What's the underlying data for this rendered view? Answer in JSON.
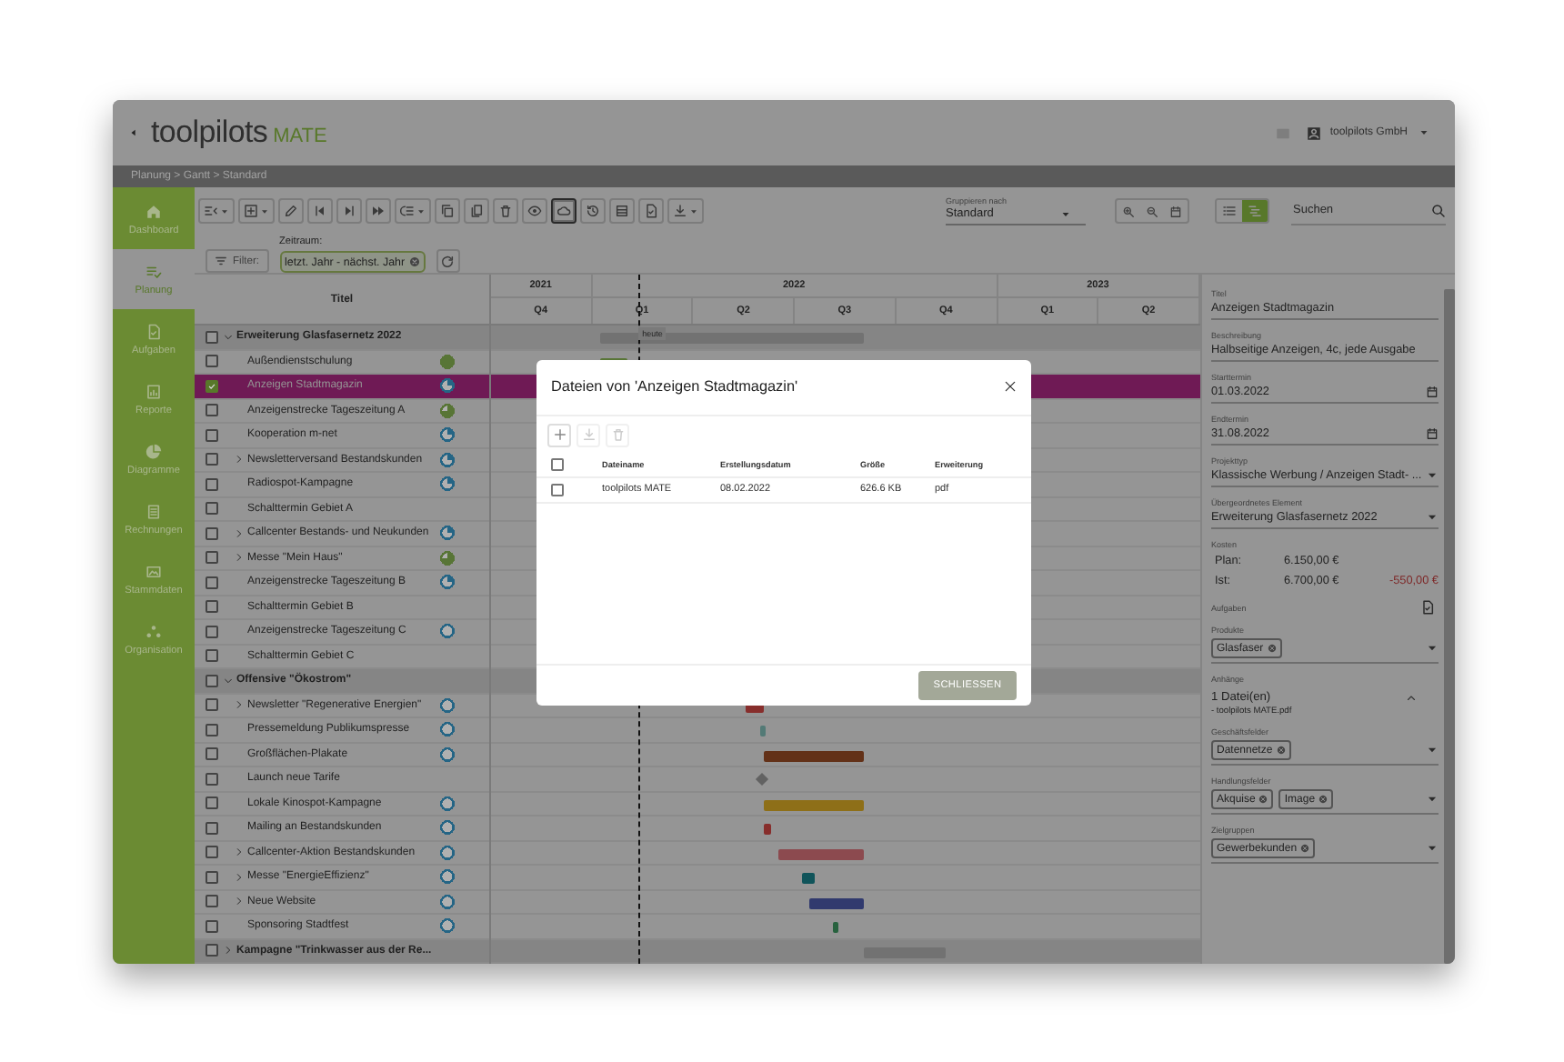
{
  "header": {
    "logo": {
      "name": "toolpilots",
      "accent": "MATE"
    },
    "company": "toolpilots GmbH"
  },
  "breadcrumb": "Planung > Gantt > Standard",
  "sidebar": {
    "items": [
      {
        "label": "Dashboard",
        "selected": false
      },
      {
        "label": "Planung",
        "selected": true
      },
      {
        "label": "Aufgaben",
        "selected": false
      },
      {
        "label": "Reporte",
        "selected": false
      },
      {
        "label": "Diagramme",
        "selected": false
      },
      {
        "label": "Rechnungen",
        "selected": false
      },
      {
        "label": "Stammdaten",
        "selected": false
      },
      {
        "label": "Organisation",
        "selected": false
      }
    ]
  },
  "toolbar": {
    "buttons": [
      {
        "dropdown": true,
        "active": false
      },
      {
        "dropdown": true,
        "active": false
      },
      {
        "dropdown": false,
        "active": false
      },
      {
        "dropdown": false,
        "active": false
      },
      {
        "dropdown": false,
        "active": false
      },
      {
        "dropdown": false,
        "active": false
      },
      {
        "dropdown": true,
        "active": false
      },
      {
        "dropdown": false,
        "active": false
      },
      {
        "dropdown": false,
        "active": false
      },
      {
        "dropdown": false,
        "active": false
      },
      {
        "dropdown": false,
        "active": false
      },
      {
        "dropdown": false,
        "active": true
      },
      {
        "dropdown": false,
        "active": false
      },
      {
        "dropdown": false,
        "active": false
      },
      {
        "dropdown": false,
        "active": false
      },
      {
        "dropdown": true,
        "active": false
      }
    ],
    "group_by": {
      "label": "Gruppieren nach",
      "value": "Standard"
    },
    "view_toggle": [
      {
        "selected": false
      },
      {
        "selected": true
      }
    ],
    "search": {
      "placeholder": "Suchen"
    },
    "filter": {
      "label": "Filter:"
    },
    "period": {
      "label": "Zeitraum:",
      "value": "letzt. Jahr - nächst. Jahr"
    }
  },
  "gantt": {
    "title_column": "Titel",
    "years": [
      {
        "label": "2021",
        "quarters": [
          "Q4"
        ]
      },
      {
        "label": "2022",
        "quarters": [
          "Q1",
          "Q2",
          "Q3",
          "Q4"
        ]
      },
      {
        "label": "2023",
        "quarters": [
          "Q1",
          "Q2"
        ]
      }
    ],
    "today": {
      "label": "heute"
    },
    "rows": [
      {
        "title": "Erweiterung Glasfasernetz 2022",
        "kind": "group",
        "expanded": true,
        "checked": false,
        "selected": false,
        "bar": {
          "kind": "bar",
          "color": "#727272"
        },
        "children": [
          {
            "title": "Außendienstschulung",
            "kind": "task",
            "checked": false,
            "selected": false,
            "status": {
              "kind": "full",
              "color": "#587536"
            },
            "bar": {
              "kind": "bar",
              "color": "#587536"
            }
          },
          {
            "title": "Anzeigen Stadtmagazin",
            "kind": "task",
            "checked": true,
            "selected": true,
            "status": {
              "kind": "quarter",
              "color": "#256585"
            }
          },
          {
            "title": "Anzeigenstrecke Tageszeitung A",
            "kind": "task",
            "checked": false,
            "selected": false,
            "status": {
              "kind": "three-quarter",
              "color": "#587536"
            }
          },
          {
            "title": "Kooperation m-net",
            "kind": "task",
            "checked": false,
            "selected": false,
            "status": {
              "kind": "quarter",
              "color": "#256585"
            }
          },
          {
            "title": "Newsletterversand Bestandskunden",
            "kind": "task",
            "expanded": false,
            "checked": false,
            "selected": false,
            "status": {
              "kind": "quarter",
              "color": "#256585"
            }
          },
          {
            "title": "Radiospot-Kampagne",
            "kind": "task",
            "checked": false,
            "selected": false,
            "status": {
              "kind": "quarter",
              "color": "#256585"
            }
          },
          {
            "title": "Schalttermin Gebiet A",
            "kind": "task",
            "checked": false,
            "selected": false
          },
          {
            "title": "Callcenter Bestands- und Neukunden",
            "kind": "task",
            "expanded": false,
            "checked": false,
            "selected": false,
            "status": {
              "kind": "quarter",
              "color": "#256585"
            }
          },
          {
            "title": "Messe \"Mein Haus\"",
            "kind": "task",
            "expanded": false,
            "checked": false,
            "selected": false,
            "status": {
              "kind": "three-quarter",
              "color": "#587536"
            }
          },
          {
            "title": "Anzeigenstrecke Tageszeitung B",
            "kind": "task",
            "checked": false,
            "selected": false,
            "status": {
              "kind": "quarter",
              "color": "#256585"
            }
          },
          {
            "title": "Schalttermin Gebiet B",
            "kind": "task",
            "checked": false,
            "selected": false
          },
          {
            "title": "Anzeigenstrecke Tageszeitung C",
            "kind": "task",
            "checked": false,
            "selected": false,
            "status": {
              "kind": "empty",
              "color": "#256585"
            }
          },
          {
            "title": "Schalttermin Gebiet C",
            "kind": "task",
            "checked": false,
            "selected": false
          }
        ]
      },
      {
        "title": "Offensive \"Ökostrom\"",
        "kind": "group",
        "expanded": true,
        "checked": false,
        "selected": false,
        "children": [
          {
            "title": "Newsletter \"Regenerative Energien\"",
            "kind": "task",
            "expanded": false,
            "checked": false,
            "selected": false,
            "status": {
              "kind": "empty",
              "color": "#256585"
            },
            "bar": {
              "kind": "bar",
              "color": "#872e2c"
            }
          },
          {
            "title": "Pressemeldung Publikumspresse",
            "kind": "task",
            "checked": false,
            "selected": false,
            "status": {
              "kind": "empty",
              "color": "#256585"
            },
            "bar": {
              "kind": "bar",
              "color": "#537a76"
            }
          },
          {
            "title": "Großflächen-Plakate",
            "kind": "task",
            "checked": false,
            "selected": false,
            "status": {
              "kind": "empty",
              "color": "#256585"
            },
            "bar": {
              "kind": "bar",
              "color": "#633118"
            }
          },
          {
            "title": "Launch neue Tarife",
            "kind": "task",
            "checked": false,
            "selected": false,
            "bar": {
              "kind": "milestone",
              "color": "#626262"
            }
          },
          {
            "title": "Lokale Kinospot-Kampagne",
            "kind": "task",
            "checked": false,
            "selected": false,
            "status": {
              "kind": "empty",
              "color": "#256585"
            },
            "bar": {
              "kind": "bar",
              "color": "#8e6f18"
            }
          },
          {
            "title": "Mailing an Bestandskunden",
            "kind": "task",
            "checked": false,
            "selected": false,
            "status": {
              "kind": "empty",
              "color": "#256585"
            },
            "bar": {
              "kind": "bar",
              "color": "#872e2c"
            }
          },
          {
            "title": "Callcenter-Aktion Bestandskunden",
            "kind": "task",
            "expanded": false,
            "checked": false,
            "selected": false,
            "status": {
              "kind": "empty",
              "color": "#256585"
            },
            "bar": {
              "kind": "bar",
              "color": "#8c4a4f"
            }
          },
          {
            "title": "Messe \"EnergieEffizienz\"",
            "kind": "task",
            "expanded": false,
            "checked": false,
            "selected": false,
            "status": {
              "kind": "empty",
              "color": "#256585"
            },
            "bar": {
              "kind": "bar",
              "color": "#10545a"
            }
          },
          {
            "title": "Neue Website",
            "kind": "task",
            "expanded": false,
            "checked": false,
            "selected": false,
            "status": {
              "kind": "empty",
              "color": "#256585"
            },
            "bar": {
              "kind": "bar",
              "color": "#313a6e"
            }
          },
          {
            "title": "Sponsoring Stadtfest",
            "kind": "task",
            "checked": false,
            "selected": false,
            "status": {
              "kind": "empty",
              "color": "#256585"
            },
            "bar": {
              "kind": "bar",
              "color": "#28623f"
            }
          }
        ]
      },
      {
        "title": "Kampagne \"Trinkwasser aus der Re...",
        "kind": "group",
        "expanded": false,
        "checked": false,
        "selected": false,
        "bar": {
          "kind": "bar",
          "color": "#727272"
        }
      }
    ]
  },
  "details": {
    "fields": [
      {
        "kind": "text",
        "label": "Titel",
        "value": "Anzeigen Stadtmagazin"
      },
      {
        "kind": "text",
        "label": "Beschreibung",
        "value": "Halbseitige Anzeigen, 4c, jede Ausgabe"
      },
      {
        "kind": "date",
        "label": "Starttermin",
        "value": "01.03.2022"
      },
      {
        "kind": "date",
        "label": "Endtermin",
        "value": "31.08.2022"
      },
      {
        "kind": "select",
        "label": "Projekttyp",
        "value": "Klassische Werbung / Anzeigen Stadt- ..."
      },
      {
        "kind": "select",
        "label": "Übergeordnetes Element",
        "value": "Erweiterung Glasfasernetz 2022"
      },
      {
        "kind": "costs",
        "label": "Kosten",
        "rows": [
          {
            "label": "Plan:",
            "value": "6.150,00 €"
          },
          {
            "label": "Ist:",
            "value": "6.700,00 €",
            "difference": "-550,00 €"
          }
        ]
      },
      {
        "kind": "tasks",
        "label": "Aufgaben"
      },
      {
        "kind": "chips",
        "label": "Produkte",
        "chips": [
          "Glasfaser"
        ]
      },
      {
        "kind": "attachments",
        "label": "Anhänge",
        "count": "1 Datei(en)",
        "expanded": true,
        "files": [
          "- toolpilots MATE.pdf"
        ]
      },
      {
        "kind": "chips",
        "label": "Geschäftsfelder",
        "chips": [
          "Datennetze"
        ]
      },
      {
        "kind": "chips",
        "label": "Handlungsfelder",
        "chips": [
          "Akquise",
          "Image"
        ]
      },
      {
        "kind": "chips",
        "label": "Zielgruppen",
        "chips": [
          "Gewerbekunden"
        ]
      }
    ]
  },
  "dialog": {
    "title": "Dateien von 'Anzeigen Stadtmagazin'",
    "tools": [
      {
        "disabled": false
      },
      {
        "disabled": true
      },
      {
        "disabled": true
      }
    ],
    "all_checked": false,
    "columns": [
      "Dateiname",
      "Erstellungsdatum",
      "Größe",
      "Erweiterung"
    ],
    "rows": [
      {
        "checked": false,
        "cells": [
          "toolpilots MATE",
          "08.02.2022",
          "626.6 KB",
          "pdf"
        ]
      }
    ],
    "button": "SCHLIESSEN"
  }
}
